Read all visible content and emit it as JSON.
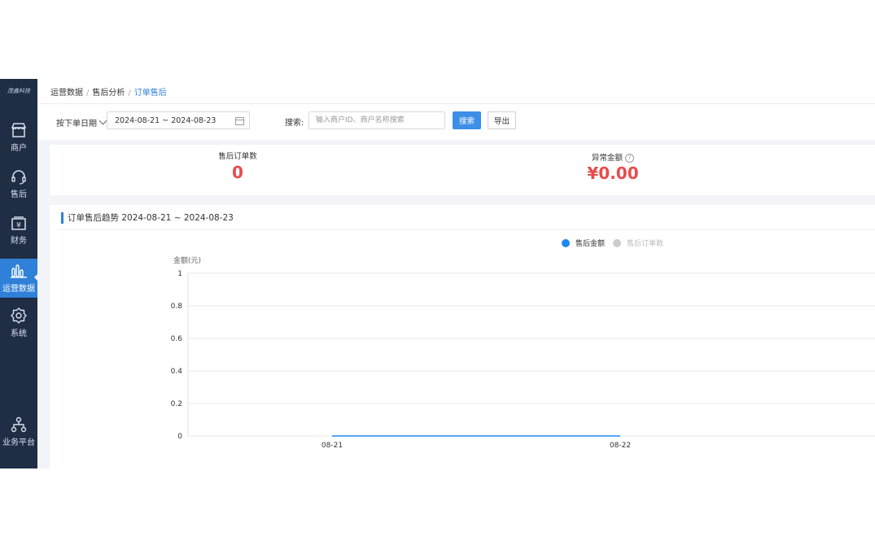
{
  "sidebar": {
    "logo": "茂鑫科技",
    "items": [
      {
        "label": "商户",
        "icon": "shop-icon"
      },
      {
        "label": "售后",
        "icon": "headset-icon"
      },
      {
        "label": "财务",
        "icon": "finance-icon"
      },
      {
        "label": "运营数据",
        "icon": "bar-chart-icon",
        "active": true
      },
      {
        "label": "系统",
        "icon": "gear-icon"
      },
      {
        "label": "业务平台",
        "icon": "network-icon"
      }
    ]
  },
  "breadcrumb": [
    "运营数据",
    "售后分析",
    "订单售后"
  ],
  "filter": {
    "date_type": "按下单日期",
    "date_range": "2024-08-21 ~ 2024-08-23",
    "search_label": "搜索:",
    "search_placeholder": "输入商户ID、商户名称搜索",
    "search_value": "",
    "search_button": "搜索",
    "export_button": "导出"
  },
  "stats": {
    "order_count": {
      "label": "售后订单数",
      "value": "0"
    },
    "amount": {
      "label": "异常金额",
      "value": "¥0.00"
    }
  },
  "colors": {
    "sidebar": "#1f2d45",
    "accent": "#2f80d8",
    "danger": "#e84c4c"
  },
  "chart_data": {
    "title": "订单售后趋势 2024-08-21 ~ 2024-08-23",
    "type": "line",
    "ylabel": "金额(元)",
    "ylim": [
      0,
      1
    ],
    "yticks": [
      "1",
      "0.8",
      "0.6",
      "0.4",
      "0.2",
      "0"
    ],
    "categories": [
      "08-21",
      "08-22"
    ],
    "series": [
      {
        "name": "售后金额",
        "values": [
          0,
          0
        ],
        "color": "#1e88f0",
        "active": true
      },
      {
        "name": "售后订单数",
        "values": [
          0,
          0
        ],
        "color": "#cccccc",
        "active": false
      }
    ],
    "legend": "top-center",
    "grid": true
  }
}
